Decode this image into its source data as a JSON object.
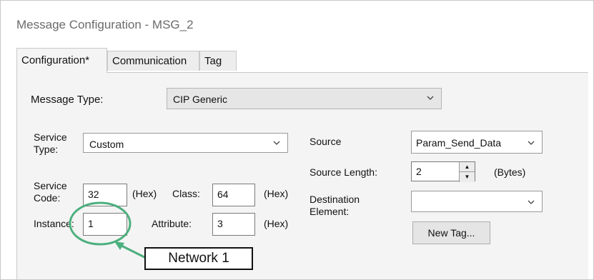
{
  "window": {
    "title": "Message Configuration - MSG_2"
  },
  "tabs": [
    {
      "label": "Configuration*"
    },
    {
      "label": "Communication"
    },
    {
      "label": "Tag"
    }
  ],
  "config": {
    "message_type_label": "Message Type:",
    "message_type_value": "CIP Generic",
    "service_type_label": "Service\nType:",
    "service_type_value": "Custom",
    "service_code_label": "Service\nCode:",
    "service_code_value": "32",
    "hex_unit": "(Hex)",
    "class_label": "Class:",
    "class_value": "64",
    "instance_label": "Instance:",
    "instance_value": "1",
    "attribute_label": "Attribute:",
    "attribute_value": "3",
    "source_label": "Source",
    "source_value": "Param_Send_Data",
    "source_length_label": "Source Length:",
    "source_length_value": "2",
    "bytes_unit": "(Bytes)",
    "destination_label": "Destination\nElement:",
    "destination_value": "",
    "new_tag_label": "New Tag..."
  },
  "annotation": {
    "callout_text": "Network 1",
    "color": "#4caf7d"
  },
  "icons": {
    "dropdown": "chevron-down-icon",
    "spin_up": "arrow-up-icon",
    "spin_down": "arrow-down-icon"
  }
}
